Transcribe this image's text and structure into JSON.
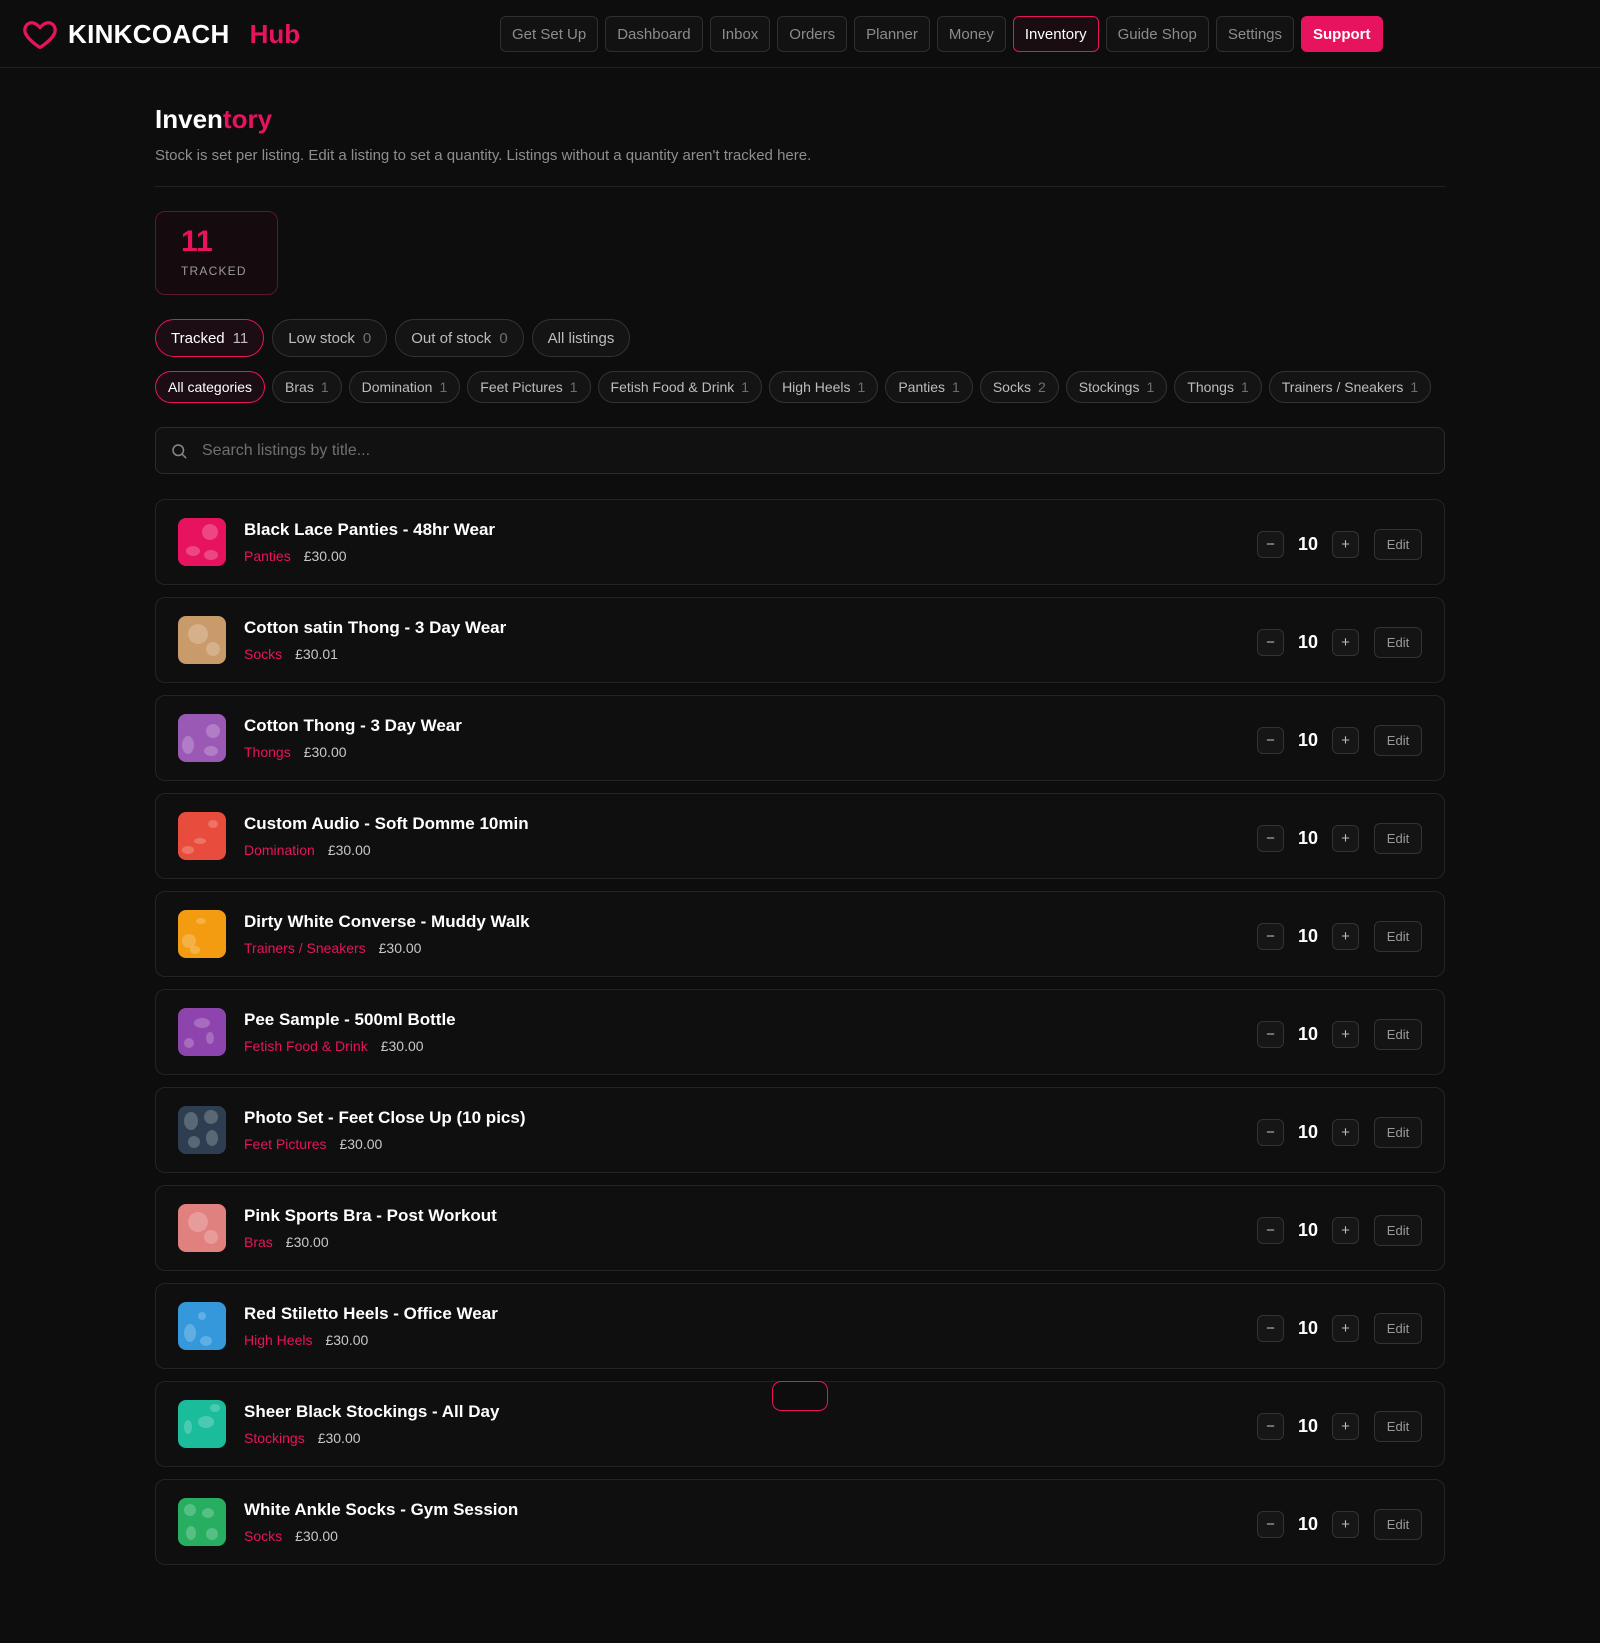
{
  "brand": {
    "name": "KINKCOACH",
    "hub": "Hub"
  },
  "nav": [
    {
      "label": "Get Set Up",
      "state": "default"
    },
    {
      "label": "Dashboard",
      "state": "default"
    },
    {
      "label": "Inbox",
      "state": "default"
    },
    {
      "label": "Orders",
      "state": "default"
    },
    {
      "label": "Planner",
      "state": "default"
    },
    {
      "label": "Money",
      "state": "default"
    },
    {
      "label": "Inventory",
      "state": "active"
    },
    {
      "label": "Guide Shop",
      "state": "default"
    },
    {
      "label": "Settings",
      "state": "default"
    },
    {
      "label": "Support",
      "state": "support"
    }
  ],
  "page": {
    "title_start": "Inven",
    "title_accent": "tory",
    "subtitle": "Stock is set per listing. Edit a listing to set a quantity. Listings without a quantity aren't tracked here."
  },
  "stat": {
    "value": "11",
    "label": "TRACKED"
  },
  "filters": [
    {
      "label": "Tracked",
      "count": "11",
      "active": true
    },
    {
      "label": "Low stock",
      "count": "0",
      "active": false
    },
    {
      "label": "Out of stock",
      "count": "0",
      "active": false
    },
    {
      "label": "All listings",
      "count": "",
      "active": false
    }
  ],
  "categories": [
    {
      "label": "All categories",
      "count": "",
      "active": true
    },
    {
      "label": "Bras",
      "count": "1",
      "active": false
    },
    {
      "label": "Domination",
      "count": "1",
      "active": false
    },
    {
      "label": "Feet Pictures",
      "count": "1",
      "active": false
    },
    {
      "label": "Fetish Food & Drink",
      "count": "1",
      "active": false
    },
    {
      "label": "High Heels",
      "count": "1",
      "active": false
    },
    {
      "label": "Panties",
      "count": "1",
      "active": false
    },
    {
      "label": "Socks",
      "count": "2",
      "active": false
    },
    {
      "label": "Stockings",
      "count": "1",
      "active": false
    },
    {
      "label": "Thongs",
      "count": "1",
      "active": false
    },
    {
      "label": "Trainers / Sneakers",
      "count": "1",
      "active": false
    }
  ],
  "search": {
    "placeholder": "Search listings by title..."
  },
  "controls": {
    "minus": "−",
    "plus": "+",
    "edit": "Edit"
  },
  "listings": [
    {
      "title": "Black Lace Panties - 48hr Wear",
      "category": "Panties",
      "price": "£30.00",
      "qty": "10",
      "color": "#e8135f"
    },
    {
      "title": "Cotton satin Thong - 3 Day Wear",
      "category": "Socks",
      "price": "£30.01",
      "qty": "10",
      "color": "#c99a6a"
    },
    {
      "title": "Cotton Thong - 3 Day Wear",
      "category": "Thongs",
      "price": "£30.00",
      "qty": "10",
      "color": "#9b59b6"
    },
    {
      "title": "Custom Audio - Soft Domme 10min",
      "category": "Domination",
      "price": "£30.00",
      "qty": "10",
      "color": "#e74c3c"
    },
    {
      "title": "Dirty White Converse - Muddy Walk",
      "category": "Trainers / Sneakers",
      "price": "£30.00",
      "qty": "10",
      "color": "#f39c12"
    },
    {
      "title": "Pee Sample - 500ml Bottle",
      "category": "Fetish Food & Drink",
      "price": "£30.00",
      "qty": "10",
      "color": "#8e44ad"
    },
    {
      "title": "Photo Set - Feet Close Up (10 pics)",
      "category": "Feet Pictures",
      "price": "£30.00",
      "qty": "10",
      "color": "#2c3e50"
    },
    {
      "title": "Pink Sports Bra - Post Workout",
      "category": "Bras",
      "price": "£30.00",
      "qty": "10",
      "color": "#e0807f"
    },
    {
      "title": "Red Stiletto Heels - Office Wear",
      "category": "High Heels",
      "price": "£30.00",
      "qty": "10",
      "color": "#3498db"
    },
    {
      "title": "Sheer Black Stockings - All Day",
      "category": "Stockings",
      "price": "£30.00",
      "qty": "10",
      "color": "#1abc9c"
    },
    {
      "title": "White Ankle Socks - Gym Session",
      "category": "Socks",
      "price": "£30.00",
      "qty": "10",
      "color": "#27ae60"
    }
  ]
}
